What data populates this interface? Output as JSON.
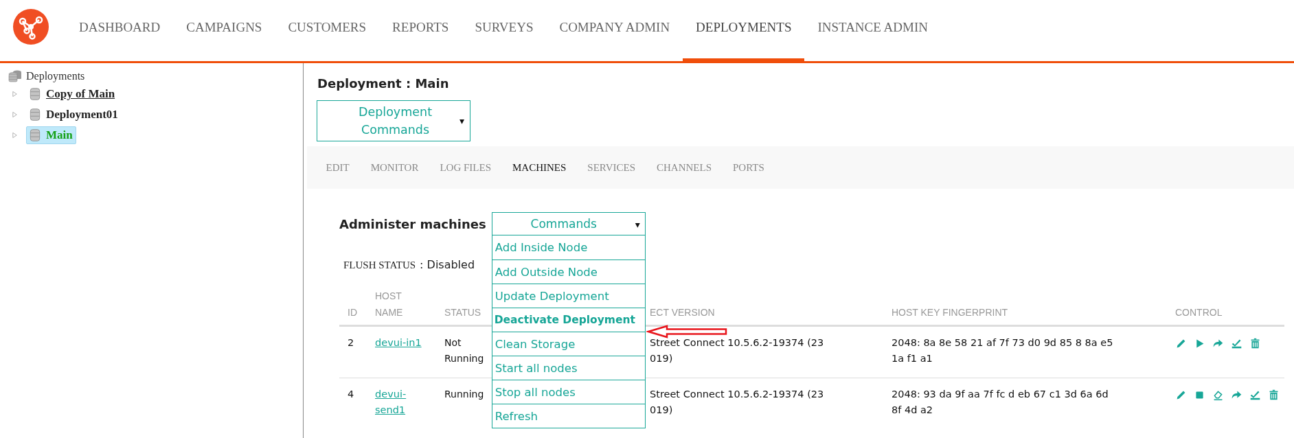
{
  "nav": {
    "items": [
      {
        "label": "DASHBOARD",
        "selected": false
      },
      {
        "label": "CAMPAIGNS",
        "selected": false
      },
      {
        "label": "CUSTOMERS",
        "selected": false
      },
      {
        "label": "REPORTS",
        "selected": false
      },
      {
        "label": "SURVEYS",
        "selected": false
      },
      {
        "label": "COMPANY ADMIN",
        "selected": false
      },
      {
        "label": "DEPLOYMENTS",
        "selected": true
      },
      {
        "label": "INSTANCE ADMIN",
        "selected": false
      }
    ]
  },
  "tree": {
    "label": "Deployments",
    "children": [
      {
        "label": "Copy of Main",
        "selected": false,
        "hovered": true,
        "expanded": false
      },
      {
        "label": "Deployment01",
        "selected": false,
        "hovered": false,
        "expanded": false
      },
      {
        "label": "Main",
        "selected": true,
        "hovered": false,
        "expanded": false
      }
    ]
  },
  "title": "Deployment : Main",
  "deployment_commands": {
    "label": "Deployment Commands",
    "caret": "▾"
  },
  "tabs": [
    {
      "label": "EDIT",
      "selected": false
    },
    {
      "label": "MONITOR",
      "selected": false
    },
    {
      "label": "LOG FILES",
      "selected": false
    },
    {
      "label": "MACHINES",
      "selected": true
    },
    {
      "label": "SERVICES",
      "selected": false
    },
    {
      "label": "CHANNELS",
      "selected": false
    },
    {
      "label": "PORTS",
      "selected": false
    }
  ],
  "machines": {
    "heading": "Administer machines",
    "commands": {
      "label": "Commands",
      "caret": "▾",
      "expanded": true,
      "items": [
        {
          "label": "Add Inside Node",
          "highlighted": false
        },
        {
          "label": "Add Outside Node",
          "highlighted": false
        },
        {
          "label": "Update Deployment",
          "highlighted": false
        },
        {
          "label": "Deactivate Deployment",
          "highlighted": true
        },
        {
          "label": "Clean Storage",
          "highlighted": false
        },
        {
          "label": "Start all nodes",
          "highlighted": false
        },
        {
          "label": "Stop all nodes",
          "highlighted": false
        },
        {
          "label": "Refresh",
          "highlighted": false
        }
      ]
    },
    "flush_status": {
      "label": "FLUSH STATUS",
      "value": ": Disabled"
    },
    "table": {
      "columns": [
        "ID",
        "HOST NAME",
        "STATUS",
        "ECT VERSION",
        "HOST KEY FINGERPRINT",
        "CONTROL"
      ],
      "rows": [
        {
          "id": "2",
          "host_name": "devui-in1",
          "status": "Not Running",
          "column_4": [
            "Street Connect 10.5.6.2-19374 (23",
            "019)"
          ],
          "fingerprint": [
            "2048: 8a 8e 58 21 af 7f 73 d0 9d 85 8 8a e5",
            "1a f1 a1"
          ],
          "controls": [
            {
              "kind": "edit"
            },
            {
              "kind": "start"
            },
            {
              "kind": "forward"
            },
            {
              "kind": "install"
            },
            {
              "kind": "delete"
            }
          ]
        },
        {
          "id": "4",
          "host_name": "devui-send1",
          "status": "Running",
          "column_4": [
            "Street Connect 10.5.6.2-19374 (23",
            "019)"
          ],
          "fingerprint": [
            "2048: 93 da 9f aa 7f fc d eb 67 c1 3d 6a 6d",
            "8f 4d a2"
          ],
          "controls": [
            {
              "kind": "edit"
            },
            {
              "kind": "stop"
            },
            {
              "kind": "clean"
            },
            {
              "kind": "forward"
            },
            {
              "kind": "install"
            },
            {
              "kind": "delete"
            }
          ]
        }
      ]
    }
  }
}
